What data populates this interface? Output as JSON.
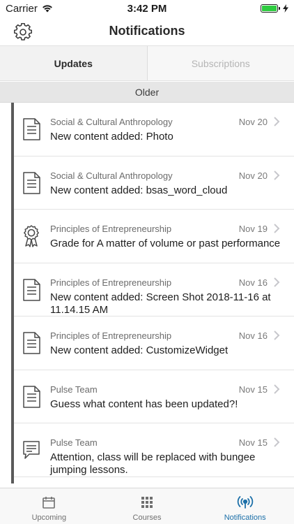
{
  "status_bar": {
    "carrier": "Carrier",
    "time": "3:42 PM",
    "battery_level_fraction": 1.0
  },
  "nav": {
    "title": "Notifications",
    "settings_icon": "gear-icon"
  },
  "tabs": [
    {
      "label": "Updates",
      "active": true
    },
    {
      "label": "Subscriptions",
      "active": false
    }
  ],
  "section": {
    "title": "Older"
  },
  "notifications": [
    {
      "course": "Social & Cultural Anthropology",
      "date": "Nov 20",
      "text": "New content added: Photo",
      "icon": "document-icon"
    },
    {
      "course": "Social & Cultural Anthropology",
      "date": "Nov 20",
      "text": "New content added: bsas_word_cloud",
      "icon": "document-icon"
    },
    {
      "course": "Principles of Entrepreneurship",
      "date": "Nov 19",
      "text": "Grade for A matter of volume or past performance",
      "icon": "award-ribbon-icon"
    },
    {
      "course": "Principles of Entrepreneurship",
      "date": "Nov 16",
      "text": "New content added: Screen Shot 2018-11-16 at 11.14.15 AM",
      "icon": "document-icon"
    },
    {
      "course": "Principles of Entrepreneurship",
      "date": "Nov 16",
      "text": "New content added: CustomizeWidget",
      "icon": "document-icon"
    },
    {
      "course": "Pulse Team",
      "date": "Nov 15",
      "text": "Guess what content has been updated?!",
      "icon": "document-icon"
    },
    {
      "course": "Pulse Team",
      "date": "Nov 15",
      "text": "Attention, class will be replaced with bungee jumping lessons.",
      "icon": "chat-bubble-icon"
    }
  ],
  "tab_bar": [
    {
      "label": "Upcoming",
      "icon": "calendar-icon",
      "active": false
    },
    {
      "label": "Courses",
      "icon": "grid-icon",
      "active": false
    },
    {
      "label": "Notifications",
      "icon": "broadcast-icon",
      "active": true
    }
  ],
  "colors": {
    "accent": "#1b6fa8",
    "battery": "#2ecc40"
  }
}
